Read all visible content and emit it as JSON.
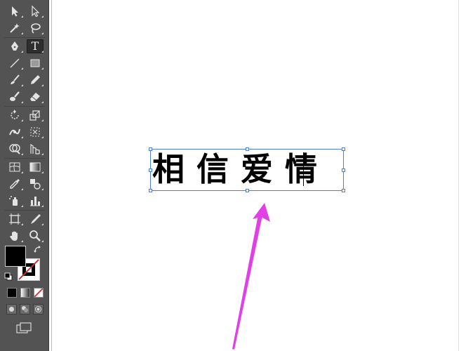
{
  "canvas": {
    "text_content": "相信爱情"
  },
  "tools": [
    {
      "name": "selection-tool",
      "icon": "arrow-icon"
    },
    {
      "name": "direct-selection-tool",
      "icon": "white-arrow-icon"
    },
    {
      "name": "magic-wand-tool",
      "icon": "magic-wand-icon"
    },
    {
      "name": "lasso-tool",
      "icon": "lasso-icon"
    },
    {
      "name": "pen-tool",
      "icon": "pen-icon"
    },
    {
      "name": "type-tool",
      "icon": "type-icon",
      "glyph": "T",
      "active": true
    },
    {
      "name": "line-segment-tool",
      "icon": "line-icon"
    },
    {
      "name": "rectangle-tool",
      "icon": "rectangle-icon"
    },
    {
      "name": "paintbrush-tool",
      "icon": "brush-icon"
    },
    {
      "name": "pencil-tool",
      "icon": "pencil-icon"
    },
    {
      "name": "blob-brush-tool",
      "icon": "blob-brush-icon"
    },
    {
      "name": "eraser-tool",
      "icon": "eraser-icon"
    },
    {
      "name": "rotate-tool",
      "icon": "rotate-icon"
    },
    {
      "name": "scale-tool",
      "icon": "scale-icon"
    },
    {
      "name": "width-tool",
      "icon": "width-icon"
    },
    {
      "name": "free-transform-tool",
      "icon": "free-transform-icon"
    },
    {
      "name": "shape-builder-tool",
      "icon": "shape-builder-icon"
    },
    {
      "name": "perspective-grid-tool",
      "icon": "perspective-grid-icon"
    },
    {
      "name": "mesh-tool",
      "icon": "mesh-icon"
    },
    {
      "name": "gradient-tool",
      "icon": "gradient-icon"
    },
    {
      "name": "eyedropper-tool",
      "icon": "eyedropper-icon"
    },
    {
      "name": "blend-tool",
      "icon": "blend-icon"
    },
    {
      "name": "symbol-sprayer-tool",
      "icon": "symbol-sprayer-icon"
    },
    {
      "name": "column-graph-tool",
      "icon": "column-graph-icon"
    },
    {
      "name": "artboard-tool",
      "icon": "artboard-icon"
    },
    {
      "name": "slice-tool",
      "icon": "slice-icon"
    },
    {
      "name": "hand-tool",
      "icon": "hand-icon"
    },
    {
      "name": "zoom-tool",
      "icon": "zoom-icon"
    }
  ],
  "colors": {
    "panel": "#535353",
    "selection": "#4f7ddd",
    "arrow": "#e040e6",
    "fill": "#000000",
    "stroke": "#ffffff"
  }
}
